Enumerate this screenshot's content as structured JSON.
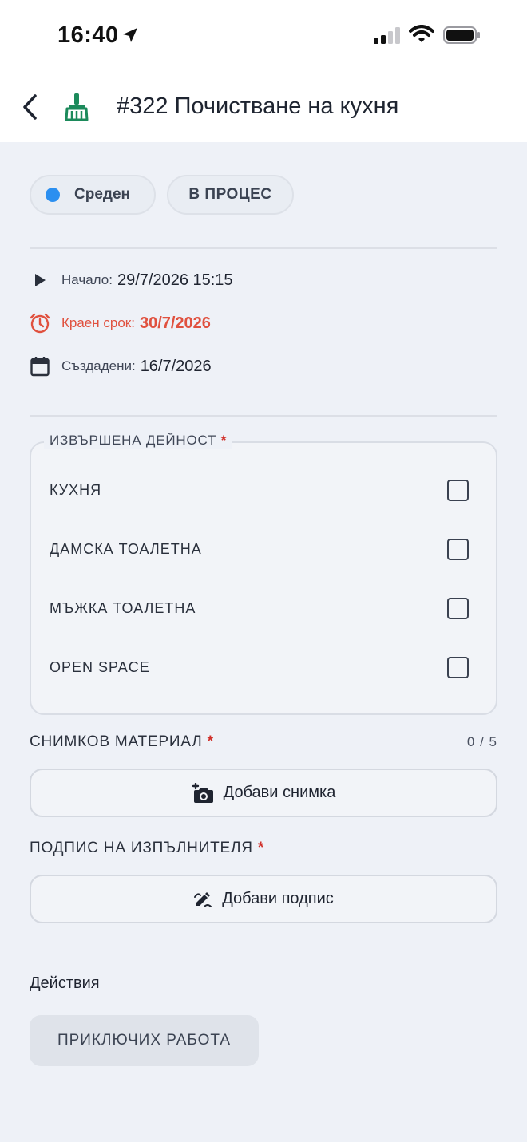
{
  "status_bar": {
    "time": "16:40"
  },
  "header": {
    "title": "#322 Почистване на кухня"
  },
  "chips": {
    "priority": "Среден",
    "status": "В ПРОЦЕС"
  },
  "colors": {
    "priority_dot": "#2b8ff0",
    "deadline": "#e0513f",
    "required": "#d0302a",
    "broom_icon": "#1c8a5b"
  },
  "info": {
    "start_label": "Начало:",
    "start_value": "29/7/2026 15:15",
    "deadline_label": "Краен срок:",
    "deadline_value": "30/7/2026",
    "created_label": "Създадени:",
    "created_value": "16/7/2026"
  },
  "activity": {
    "legend": "ИЗВЪРШЕНА ДЕЙНОСТ",
    "required_mark": "*",
    "items": [
      {
        "label": "КУХНЯ",
        "checked": false
      },
      {
        "label": "ДАМСКА ТОАЛЕТНА",
        "checked": false
      },
      {
        "label": "МЪЖКА ТОАЛЕТНА",
        "checked": false
      },
      {
        "label": "OPEN SPACE",
        "checked": false
      }
    ]
  },
  "photos": {
    "title": "СНИМКОВ МАТЕРИАЛ",
    "required_mark": "*",
    "count": "0 / 5",
    "add_label": "Добави снимка"
  },
  "signature": {
    "title": "ПОДПИС НА ИЗПЪЛНИТЕЛЯ",
    "required_mark": "*",
    "add_label": "Добави подпис"
  },
  "actions": {
    "title": "Действия",
    "finish_label": "ПРИКЛЮЧИХ РАБОТА"
  },
  "icons": [
    "location-arrow-icon",
    "signal-icon",
    "wifi-icon",
    "battery-icon",
    "back-chevron-icon",
    "broom-icon",
    "play-icon",
    "clock-icon",
    "calendar-icon",
    "add-photo-icon",
    "signature-icon"
  ]
}
